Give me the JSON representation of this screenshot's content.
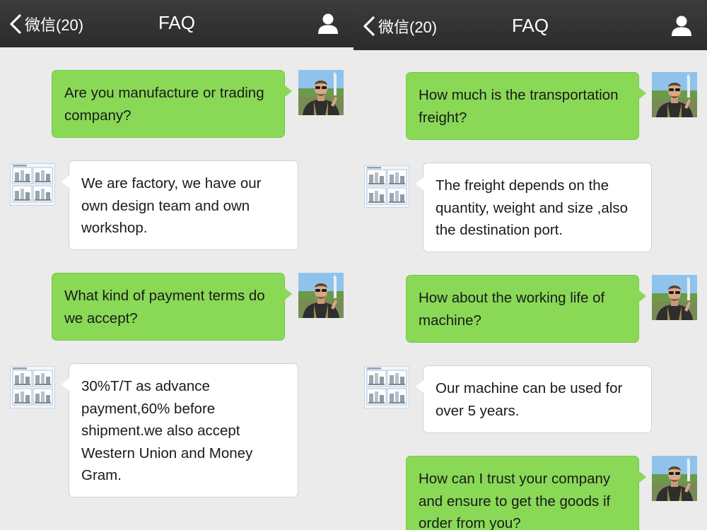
{
  "panels": [
    {
      "nav": {
        "back_label": "微信(20)",
        "title": "FAQ"
      },
      "messages": [
        {
          "side": "out",
          "text": "Are you manufacture or trading company?"
        },
        {
          "side": "in",
          "text": "We are factory, we have our own design team and own workshop."
        },
        {
          "side": "out",
          "text": "What kind of payment terms do we accept?"
        },
        {
          "side": "in",
          "text": "30%T/T as advance payment,60% before shipment.we also accept Western Union and Money Gram."
        }
      ]
    },
    {
      "nav": {
        "back_label": "微信(20)",
        "title": "FAQ"
      },
      "messages": [
        {
          "side": "out",
          "text": "How much is the transportation freight?"
        },
        {
          "side": "in",
          "text": "The freight depends on the quantity, weight and size ,also the destination port."
        },
        {
          "side": "out",
          "text": "How about the working life of machine?"
        },
        {
          "side": "in",
          "text": "Our machine can be used for over 5 years."
        },
        {
          "side": "out",
          "text": "How can I trust your company and ensure to get the goods if order from you?"
        }
      ]
    }
  ],
  "icons": {
    "back": "chevron-left-icon",
    "profile": "person-icon",
    "user_avatar": "user-photo-avatar",
    "factory_avatar": "factory-machine-catalog-avatar"
  },
  "colors": {
    "nav_bar": "#333333",
    "background": "#ebebeb",
    "outgoing_bubble": "#89d957",
    "incoming_bubble": "#ffffff"
  }
}
